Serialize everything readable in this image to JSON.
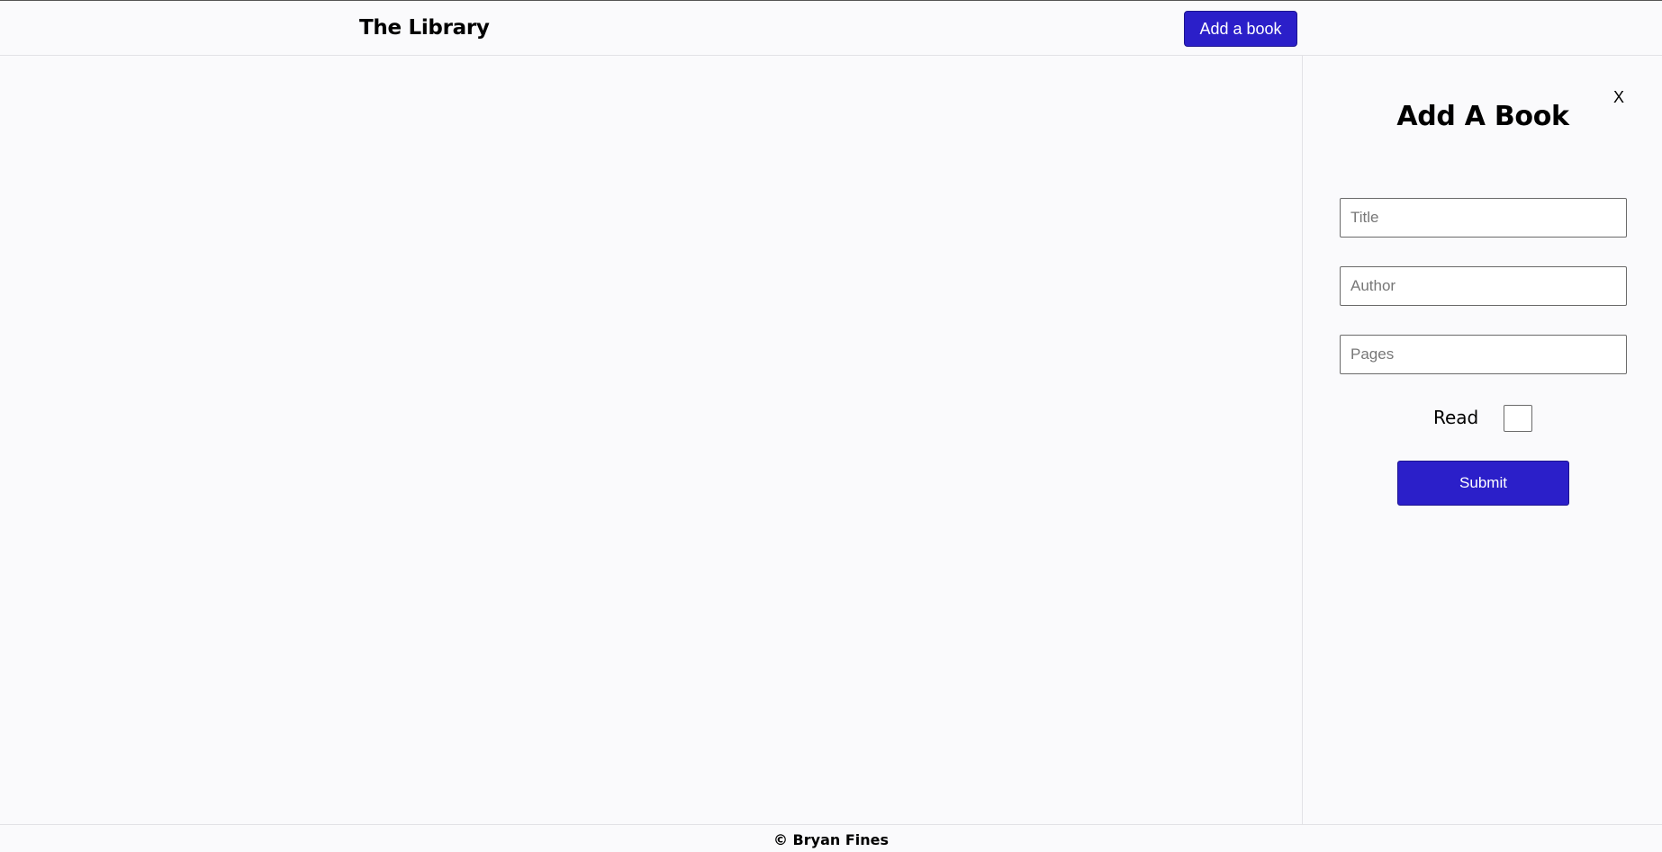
{
  "header": {
    "title": "The Library",
    "add_book_label": "Add a book"
  },
  "side_panel": {
    "close_label": "X",
    "title": "Add A Book",
    "fields": {
      "title_placeholder": "Title",
      "author_placeholder": "Author",
      "pages_placeholder": "Pages"
    },
    "read_label": "Read",
    "read_checked": false,
    "submit_label": "Submit"
  },
  "footer": {
    "text": "© Bryan Fines"
  },
  "colors": {
    "accent": "#2b1fc9",
    "background": "#fafafc",
    "border": "#e2e2e6"
  }
}
